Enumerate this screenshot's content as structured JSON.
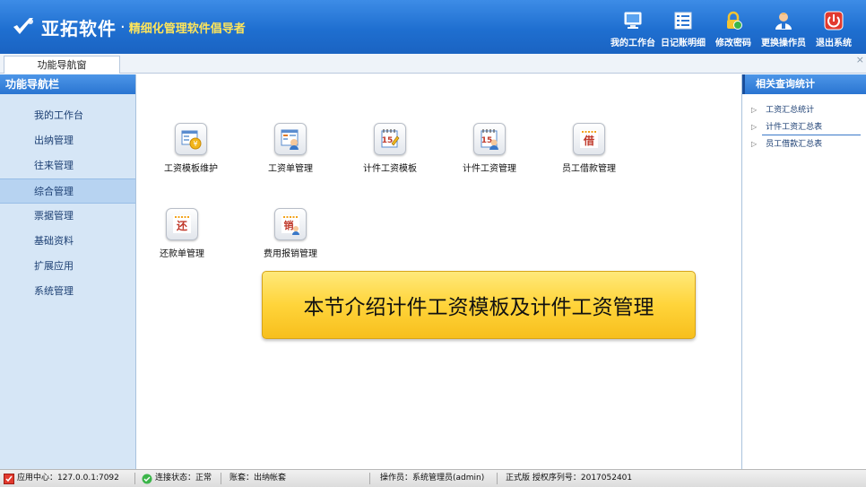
{
  "header": {
    "app_name": "亚拓软件",
    "dot": "·",
    "slogan": "精细化管理软件倡导者",
    "tools": [
      {
        "label": "我的工作台",
        "icon": "monitor-icon"
      },
      {
        "label": "日记账明细",
        "icon": "ledger-icon"
      },
      {
        "label": "修改密码",
        "icon": "lock-icon"
      },
      {
        "label": "更换操作员",
        "icon": "user-icon"
      },
      {
        "label": "退出系统",
        "icon": "power-icon"
      }
    ]
  },
  "tabs": [
    {
      "label": "功能导航窗"
    }
  ],
  "tab_close": "×",
  "leftnav": {
    "title": "功能导航栏",
    "items": [
      {
        "label": "我的工作台"
      },
      {
        "label": "出纳管理"
      },
      {
        "label": "往来管理"
      },
      {
        "label": "综合管理",
        "active": true
      },
      {
        "label": "票据管理"
      },
      {
        "label": "基础资料"
      },
      {
        "label": "扩展应用"
      },
      {
        "label": "系统管理"
      }
    ]
  },
  "main": {
    "tiles": [
      {
        "label": "工资模板维护",
        "icon": "salary-template-icon"
      },
      {
        "label": "工资单管理",
        "icon": "payslip-icon"
      },
      {
        "label": "计件工资模板",
        "icon": "piecework-template-icon"
      },
      {
        "label": "计件工资管理",
        "icon": "piecework-manage-icon"
      },
      {
        "label": "员工借款管理",
        "icon": "loan-icon",
        "glyph": "借"
      },
      {
        "label": "还款单管理",
        "icon": "repayment-icon",
        "glyph": "还"
      },
      {
        "label": "费用报销管理",
        "icon": "expense-icon",
        "glyph": "销"
      }
    ],
    "banner": "本节介绍计件工资模板及计件工资管理"
  },
  "rightpanel": {
    "title": "相关查询统计",
    "items": [
      {
        "label": "工资汇总统计"
      },
      {
        "label": "计件工资汇总表"
      },
      {
        "label": "员工借款汇总表"
      }
    ]
  },
  "statusbar": {
    "app_center": "应用中心：127.0.0.1:7092",
    "connection": "连接状态：正常",
    "account": "账套：出纳帐套",
    "operator": "操作员：系统管理员(admin)",
    "license": "正式版 授权序列号：2017052401"
  },
  "colors": {
    "header_blue": "#1f6fd0",
    "slogan_yellow": "#ffe55a",
    "banner_yellow": "#ffd43a",
    "nav_bg": "#d6e6f6"
  }
}
